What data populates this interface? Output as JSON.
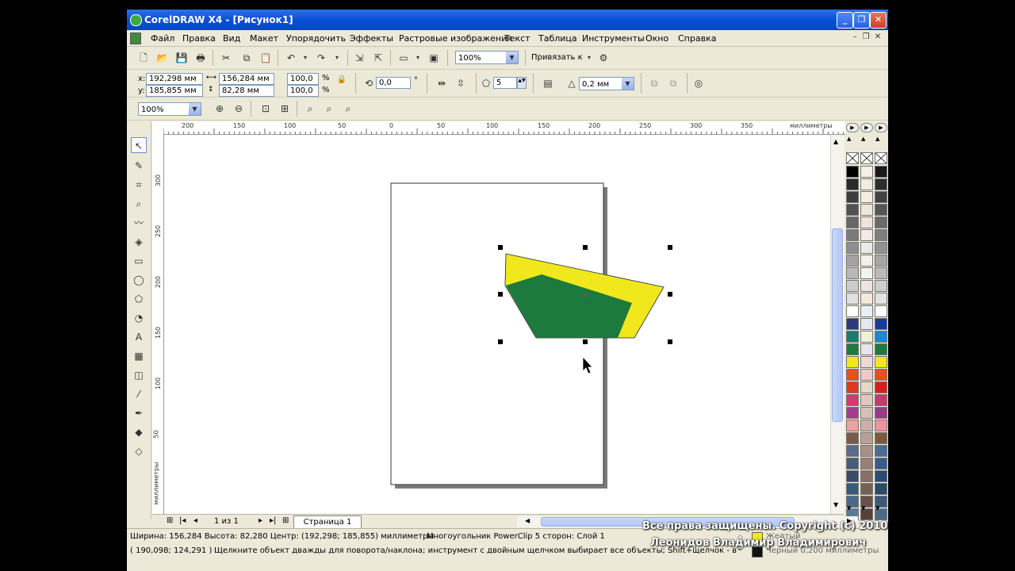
{
  "window": {
    "title": "CorelDRAW X4 - [Рисунок1]"
  },
  "menu": [
    "Файл",
    "Правка",
    "Вид",
    "Макет",
    "Упорядочить",
    "Эффекты",
    "Растровые изображения",
    "Текст",
    "Таблица",
    "Инструменты",
    "Окно",
    "Справка"
  ],
  "toolbar1": {
    "zoom": "100%",
    "snap_label": "Привязать к"
  },
  "propbar": {
    "x_label": "x:",
    "x_value": "192,298 мм",
    "y_label": "y:",
    "y_value": "185,855 мм",
    "width_value": "156,284 мм",
    "height_value": "82,28 мм",
    "scale_w": "100,0",
    "scale_h": "100,0",
    "pct": "%",
    "rotation": "0,0",
    "deg": "°",
    "sides": "5",
    "outline": "0,2 мм"
  },
  "toolbar3": {
    "zoom": "100%"
  },
  "ruler": {
    "h_ticks": [
      "200",
      "150",
      "100",
      "50",
      "0",
      "50",
      "100",
      "150",
      "200",
      "250",
      "300",
      "350"
    ],
    "h_unit": "миллиметры",
    "v_ticks": [
      "300",
      "250",
      "200",
      "150",
      "100",
      "50"
    ],
    "v_unit": "миллиметры"
  },
  "pagebar": {
    "page_count": "1 из 1",
    "page_tab": "Страница 1"
  },
  "status": {
    "line1_left": "Ширина: 156,284  Высота: 82,280  Центр: (192,298; 185,855)  миллиметры",
    "line1_mid": "Многоугольник PowerClip 5 сторон: Слой 1",
    "line2_left": "( 190,098; 124,291 )",
    "line2_hint": "Щелкните объект дважды для поворота/наклона; инструмент с двойным щелчком выбирает все объекты; Shift+щелчок - выбор нес...",
    "fill_name": "Желтый",
    "outline_name": "Черный  0,200 миллиметры"
  },
  "watermark": {
    "line1": "Все права защищены. Copyright (c) 2010",
    "line2": "Леонидов Владимир Владимирович"
  },
  "colors": {
    "green": "#1d7a3e",
    "yellow": "#f0e81c",
    "title_blue": "#0a4fd6"
  },
  "palette1": [
    "#000000",
    "#2a2a2a",
    "#3d3d3d",
    "#525252",
    "#666666",
    "#7a7a7a",
    "#8f8f8f",
    "#a3a3a3",
    "#b8b8b8",
    "#cccccc",
    "#e0e0e0",
    "#ffffff",
    "#2b3a7a",
    "#1d7a6e",
    "#1d7a3e",
    "#f0e81c",
    "#e8501c",
    "#e03a1c",
    "#d63a6e",
    "#a63a8a",
    "#f0a0a0",
    "#7a5a4a",
    "#5a6a8a",
    "#4a5a7a",
    "#3a4a6a",
    "#3a5a7a",
    "#4a6a8a",
    "#5a7a9a"
  ],
  "palette2": [
    "#f8f0e8",
    "#f0ece0",
    "#f4eee0",
    "#ece8d8",
    "#f0e4dc",
    "#f8e8e8",
    "#e8ece8",
    "#f4f0e8",
    "#f0f4f0",
    "#ece4e4",
    "#f4e8d8",
    "#e8f0f4",
    "#e4e8f0",
    "#f0f0d8",
    "#e8e4ec",
    "#f0d8d8",
    "#f0c8c8",
    "#e8d8c8",
    "#e0c8c0",
    "#d8c0b8",
    "#c8b0a8",
    "#b8a098",
    "#a89088",
    "#988078",
    "#887068",
    "#786058",
    "#685048",
    "#584038"
  ],
  "palette3": [
    "#1a1a1a",
    "#2e2e2e",
    "#424242",
    "#565656",
    "#6a6a6a",
    "#7e7e7e",
    "#929292",
    "#a6a6a6",
    "#bababa",
    "#cecece",
    "#e2e2e2",
    "#ffffff",
    "#1a3a9a",
    "#1c8ad6",
    "#1d7a3e",
    "#f0e81c",
    "#e8501c",
    "#d6201c",
    "#c83a6e",
    "#9a3a8a",
    "#f090a0",
    "#7a5a3a",
    "#4a6a9a",
    "#3a5a8a",
    "#2a4a7a",
    "#2a4a6a",
    "#3a5a7a",
    "#4a6a8a"
  ]
}
